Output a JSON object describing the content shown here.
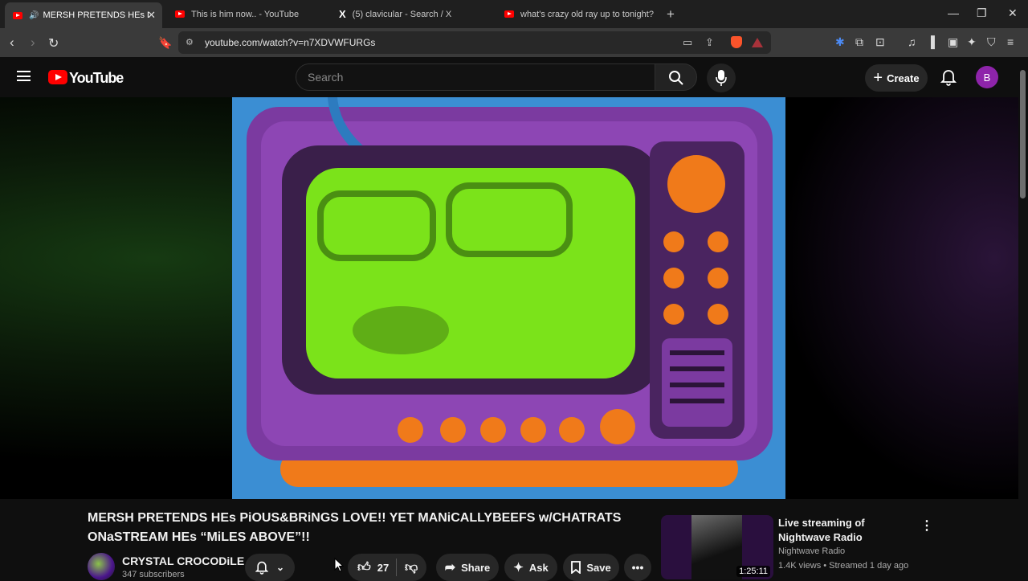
{
  "browser": {
    "tabs": [
      {
        "title": "MERSH PRETENDS HEs PiOUS",
        "active": true
      },
      {
        "title": "This is him now.. - YouTube",
        "active": false
      },
      {
        "title": "(5) clavicular - Search / X",
        "active": false
      },
      {
        "title": "what's crazy old ray up to tonight? (g",
        "active": false
      }
    ],
    "url": "youtube.com/watch?v=n7XDVWFURGs"
  },
  "youtube": {
    "logo_text": "YouTube",
    "search_placeholder": "Search",
    "create_label": "Create",
    "avatar_letter": "B"
  },
  "video": {
    "title": "MERSH PRETENDS HEs PiOUS&BRiNGS LOVE!! YET MANiCALLYBEEFS w/CHATRATS ONaSTREAM HEs “MiLES ABOVE”!!",
    "channel": "CRYSTAL CROCODiLE",
    "subscribers": "347 subscribers",
    "likes": "27",
    "share_label": "Share",
    "ask_label": "Ask",
    "save_label": "Save"
  },
  "recommendation": {
    "title": "Live streaming of Nightwave Radio",
    "channel": "Nightwave Radio",
    "meta": "1.4K views • Streamed 1 day ago",
    "duration": "1:25:11"
  },
  "colors": {
    "brand": "#ff0000",
    "avatar": "#8e24aa",
    "tv_purple": "#7b3aa0",
    "tv_orange": "#f07a1a",
    "screen_green": "#7be31a"
  }
}
